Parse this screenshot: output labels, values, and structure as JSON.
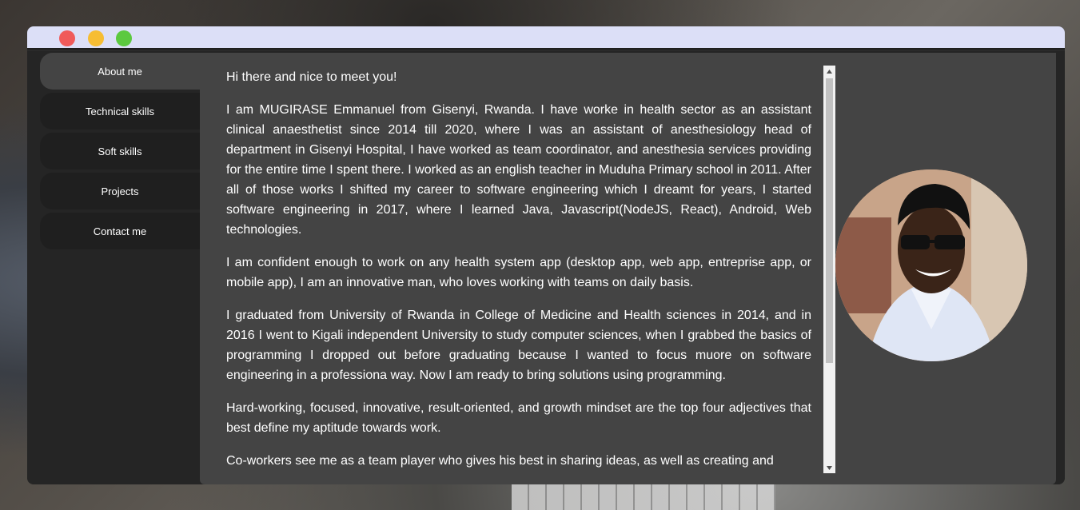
{
  "window": {
    "controls": [
      "close",
      "minimize",
      "maximize"
    ]
  },
  "sidebar": {
    "items": [
      {
        "label": "About me",
        "active": true
      },
      {
        "label": "Technical skills",
        "active": false
      },
      {
        "label": "Soft skills",
        "active": false
      },
      {
        "label": "Projects",
        "active": false
      },
      {
        "label": "Contact me",
        "active": false
      }
    ]
  },
  "about": {
    "paragraphs": [
      "Hi there and nice to meet you!",
      "I am MUGIRASE Emmanuel from Gisenyi, Rwanda. I have worke in health sector as an assistant clinical anaesthetist since 2014 till 2020, where I was an assistant of anesthesiology head of department in Gisenyi Hospital, I have worked as team coordinator, and anesthesia services providing for the entire time I spent there. I worked as an english teacher in Muduha Primary school in 2011. After all of those works I shifted my career to software engineering which I dreamt for years, I started software engineering in 2017, where I learned Java, Javascript(NodeJS, React), Android, Web technologies.",
      "I am confident enough to work on any health system app (desktop app, web app, entreprise app, or mobile app), I am an innovative man, who loves working with teams on daily basis.",
      "I graduated from University of Rwanda in College of Medicine and Health sciences in 2014, and in 2016 I went to Kigali independent University to study computer sciences, when I grabbed the basics of programming I dropped out before graduating because I wanted to focus muore on software engineering in a professiona way. Now I am ready to bring solutions using programming.",
      "Hard-working, focused, innovative, result-oriented, and growth mindset are the top four adjectives that best define my aptitude towards work.",
      "Co-workers see me as a team player who gives his best in sharing ideas, as well as creating and"
    ]
  },
  "scroll": {
    "position_fraction": 0.0,
    "visible_fraction": 0.7
  },
  "colors": {
    "titlebar": "#dcdff7",
    "panel": "#444444",
    "nav_inactive": "#1f1f1f",
    "nav_active": "#444444",
    "close": "#f05a5a",
    "minimize": "#f6bd33",
    "maximize": "#5cc93f"
  }
}
